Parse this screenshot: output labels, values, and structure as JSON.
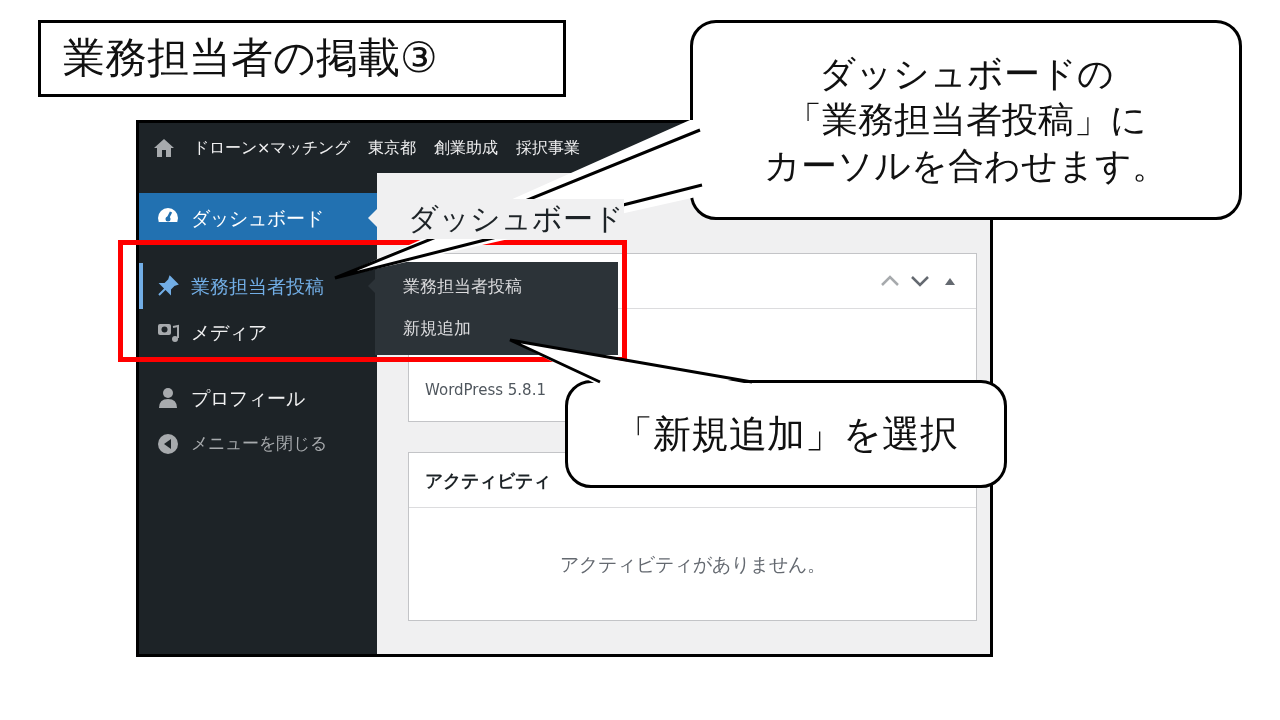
{
  "slide_title": "業務担当者の掲載③",
  "admin_bar": {
    "items": [
      "ドローン×マッチング",
      "東京都",
      "創業助成",
      "採択事業"
    ]
  },
  "sidebar": {
    "groups": [
      [
        {
          "label": "ダッシュボード",
          "kind": "menu",
          "selected": true,
          "hovered": false
        }
      ],
      [
        {
          "label": "業務担当者投稿",
          "kind": "menu",
          "selected": false,
          "hovered": true
        },
        {
          "label": "メディア",
          "kind": "menu",
          "selected": false,
          "hovered": false
        }
      ],
      [
        {
          "label": "プロフィール",
          "kind": "menu",
          "selected": false,
          "hovered": false
        },
        {
          "label": "メニューを閉じる",
          "kind": "collapse",
          "selected": false,
          "hovered": false
        }
      ]
    ]
  },
  "flyout_menu": {
    "items": [
      "業務担当者投稿",
      "新規追加"
    ]
  },
  "page_heading": "ダッシュボード",
  "panels": [
    {
      "body": "WordPress 5.8.1",
      "kind": "version"
    },
    {
      "title": "アクティビティ",
      "body": "アクティビティがありません。",
      "kind": "empty"
    }
  ],
  "callouts": [
    {
      "lines": [
        "ダッシュボードの",
        "「業務担当者投稿」に",
        "カーソルを合わせます。"
      ]
    },
    {
      "lines": [
        "「新規追加」を選択"
      ]
    }
  ]
}
